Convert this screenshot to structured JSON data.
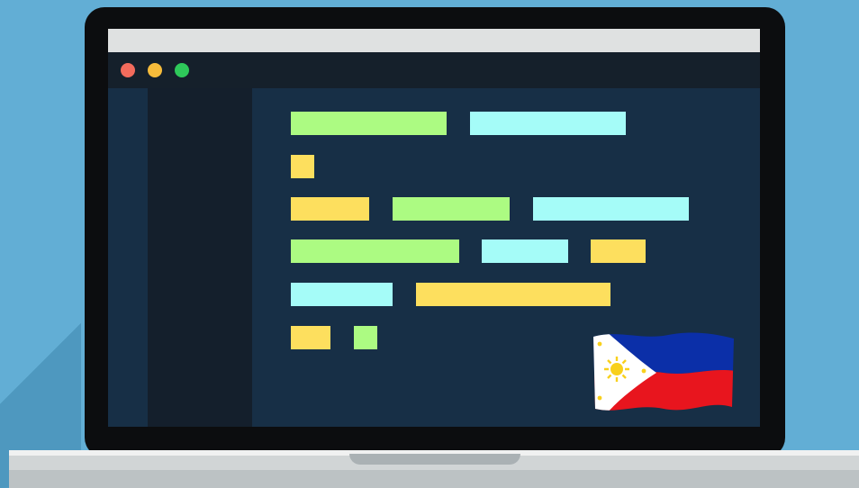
{
  "colors": {
    "background": "#62aed5",
    "bezel": "#0c0d0f",
    "editor_bg": "#172f46",
    "sidebar_bg": "#141f2c",
    "toolbar_bg": "#15202b",
    "code_green": "#acfb82",
    "code_cyan": "#a5fcf8",
    "code_yellow": "#fddf5e"
  },
  "window": {
    "controls": [
      {
        "name": "close",
        "color": "#f26b5c"
      },
      {
        "name": "minimize",
        "color": "#f7bc3b"
      },
      {
        "name": "maximize",
        "color": "#2ec95a"
      }
    ]
  },
  "code_lines": [
    [
      "green",
      "cyan"
    ],
    [
      "yellow"
    ],
    [
      "yellow",
      "green",
      "cyan"
    ],
    [
      "green",
      "cyan",
      "yellow"
    ],
    [
      "cyan",
      "yellow"
    ],
    [
      "yellow",
      "green"
    ]
  ],
  "flag": {
    "name": "philippines-flag",
    "colors": [
      "#0b2fa8",
      "#e8151e",
      "#ffffff",
      "#f8d01c"
    ]
  }
}
